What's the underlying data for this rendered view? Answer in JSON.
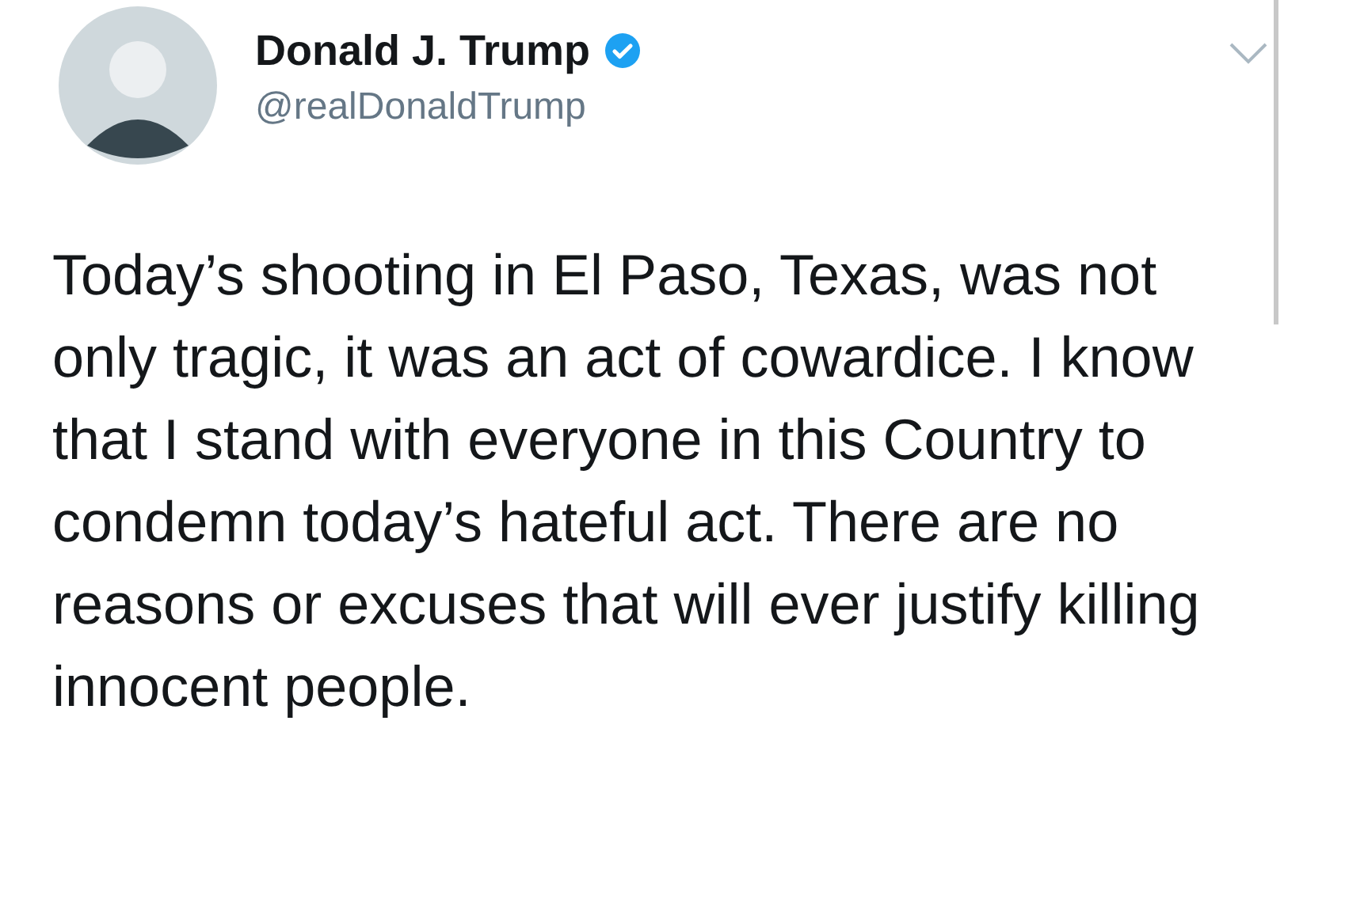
{
  "tweet": {
    "author": {
      "name": "Donald J. Trump",
      "handle": "@realDonaldTrump",
      "verified": true
    },
    "text": "Today’s shooting in El Paso, Texas, was not only tragic, it was an act of cowardice. I know that I stand with everyone in this Country to condemn today’s hateful act. There are no reasons or excuses that will ever justify killing innocent people."
  }
}
